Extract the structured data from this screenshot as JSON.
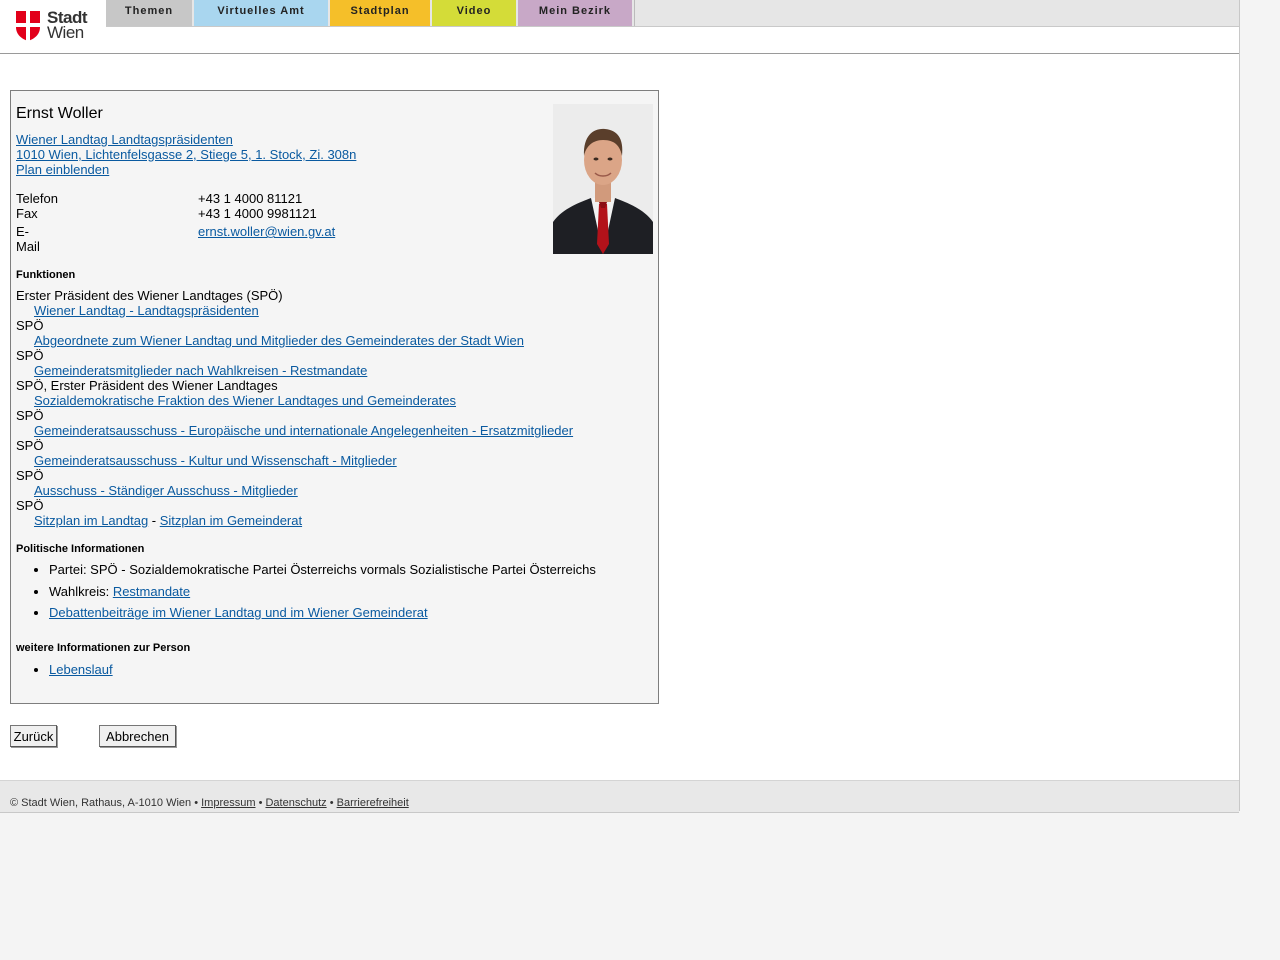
{
  "header": {
    "logo": {
      "line1": "Stadt",
      "line2": "Wien"
    },
    "nav": [
      "Themen",
      "Virtuelles Amt",
      "Stadtplan",
      "Video",
      "Mein Bezirk"
    ]
  },
  "person": {
    "name": "Ernst Woller",
    "org_link": "Wiener Landtag Landtagspräsidenten",
    "address_link": "1010 Wien, Lichtenfelsgasse 2, Stiege 5, 1. Stock, Zi. 308n",
    "plan_link": "Plan einblenden",
    "contact": [
      {
        "label": "Telefon",
        "value": "+43 1 4000 81121"
      },
      {
        "label": "Fax",
        "value": "+43 1 4000 9981121"
      },
      {
        "label": "E-Mail",
        "value": "ernst.woller@wien.gv.at"
      }
    ]
  },
  "functions": {
    "heading": "Funktionen",
    "items": [
      {
        "title": "Erster Präsident des Wiener Landtages (SPÖ)",
        "link": "Wiener Landtag - Landtagspräsidenten"
      },
      {
        "title": "SPÖ",
        "link": "Abgeordnete zum Wiener Landtag und Mitglieder des Gemeinderates der Stadt Wien"
      },
      {
        "title": "SPÖ",
        "link": "Gemeinderatsmitglieder nach Wahlkreisen - Restmandate"
      },
      {
        "title": "SPÖ, Erster Präsident des Wiener Landtages",
        "link": "Sozialdemokratische Fraktion des Wiener Landtages und Gemeinderates"
      },
      {
        "title": "SPÖ",
        "link": "Gemeinderatsausschuss - Europäische und internationale Angelegenheiten - Ersatzmitglieder"
      },
      {
        "title": "SPÖ",
        "link": "Gemeinderatsausschuss - Kultur und Wissenschaft - Mitglieder"
      },
      {
        "title": "SPÖ",
        "link": "Ausschuss - Ständiger Ausschuss - Mitglieder"
      }
    ],
    "last_title": "SPÖ",
    "sitzplan_landtag": "Sitzplan im Landtag",
    "sitzplan_sep": " - ",
    "sitzplan_gemeinderat": "Sitzplan im Gemeinderat"
  },
  "political": {
    "heading": "Politische Informationen",
    "party": "Partei: SPÖ - Sozialdemokratische Partei Österreichs vormals Sozialistische Partei Österreichs",
    "wahlkreis_label": "Wahlkreis: ",
    "wahlkreis_link": "Restmandate",
    "debates_link": "Debattenbeiträge im Wiener Landtag und im Wiener Gemeinderat"
  },
  "more": {
    "heading": "weitere Informationen zur Person",
    "lebenslauf": "Lebenslauf"
  },
  "buttons": {
    "back": "Zurück",
    "cancel": "Abbrechen"
  },
  "footer": {
    "copyright": "© Stadt Wien, Rathaus, A-1010 Wien • ",
    "impressum": "Impressum",
    "sep": " • ",
    "datenschutz": "Datenschutz",
    "barrierefreiheit": "Barrierefreiheit"
  },
  "colors": {
    "link": "#0a5aa0",
    "tab_themen": "#c7c7c7",
    "tab_virtuelles_amt": "#a9d6ef",
    "tab_stadtplan": "#f5bf29",
    "tab_video": "#d4dc38",
    "tab_mein_bezirk": "#c8a8c7",
    "logo_red": "#e2001a"
  }
}
